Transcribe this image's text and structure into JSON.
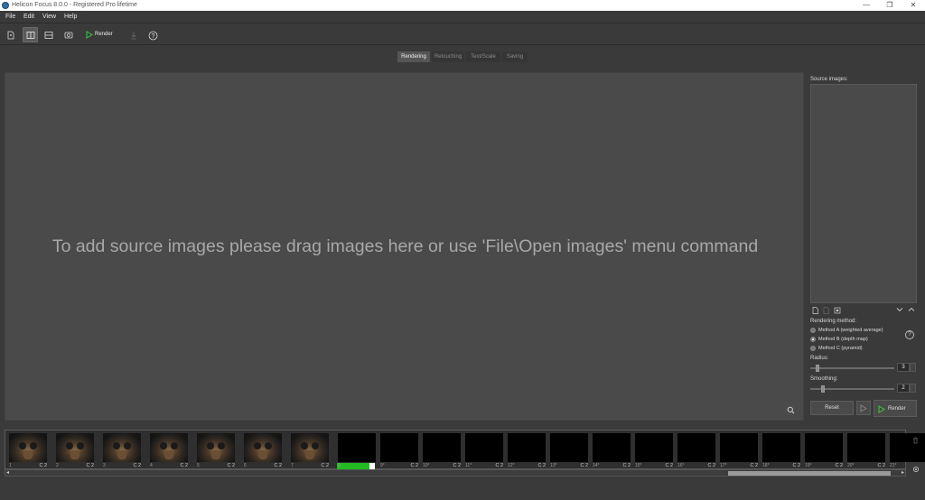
{
  "window": {
    "title": "Helicon Focus 8.0.0 - Registered Pro lifetime"
  },
  "menu": [
    "File",
    "Edit",
    "View",
    "Help"
  ],
  "toolbar": {
    "render_label": "Render"
  },
  "tabs": [
    {
      "label": "Rendering",
      "selected": true
    },
    {
      "label": "Retouching",
      "selected": false
    },
    {
      "label": "Text/Scale",
      "selected": false
    },
    {
      "label": "Saving",
      "selected": false
    }
  ],
  "canvas": {
    "message": "To add source images please drag images here or use 'File\\Open images' menu command"
  },
  "panel": {
    "source_label": "Source images:",
    "method_label": "Rendering method:",
    "methods": [
      {
        "label": "Method A (weighted average)",
        "selected": false
      },
      {
        "label": "Method B (depth map)",
        "selected": true
      },
      {
        "label": "Method C (pyramid)",
        "selected": false
      }
    ],
    "radius_label": "Radius:",
    "radius_value": "3",
    "smoothing_label": "Smoothing:",
    "smoothing_value": "2",
    "reset_label": "Reset",
    "render_label": "Render"
  },
  "filmstrip": [
    {
      "num": "1",
      "tag": "C 2",
      "kind": "photo"
    },
    {
      "num": "2",
      "tag": "C 2",
      "kind": "photo"
    },
    {
      "num": "3",
      "tag": "C 2",
      "kind": "photo"
    },
    {
      "num": "4",
      "tag": "C 2",
      "kind": "photo"
    },
    {
      "num": "5",
      "tag": "C 2",
      "kind": "photo"
    },
    {
      "num": "6",
      "tag": "C 2",
      "kind": "photo"
    },
    {
      "num": "7",
      "tag": "C 2",
      "kind": "photo"
    },
    {
      "num": "8",
      "tag": "",
      "kind": "loading",
      "progress": 0.85
    },
    {
      "num": "9*",
      "tag": "C 2",
      "kind": "black"
    },
    {
      "num": "10*",
      "tag": "C 2",
      "kind": "black"
    },
    {
      "num": "11*",
      "tag": "C 2",
      "kind": "black"
    },
    {
      "num": "12*",
      "tag": "C 2",
      "kind": "black"
    },
    {
      "num": "13*",
      "tag": "C 2",
      "kind": "black"
    },
    {
      "num": "14*",
      "tag": "C 2",
      "kind": "black"
    },
    {
      "num": "15*",
      "tag": "C 2",
      "kind": "black"
    },
    {
      "num": "16*",
      "tag": "C 2",
      "kind": "black"
    },
    {
      "num": "17*",
      "tag": "C 2",
      "kind": "black"
    },
    {
      "num": "18*",
      "tag": "C 2",
      "kind": "black"
    },
    {
      "num": "19*",
      "tag": "C 2",
      "kind": "black"
    },
    {
      "num": "20*",
      "tag": "C 2",
      "kind": "black"
    },
    {
      "num": "21*",
      "tag": "",
      "kind": "black"
    }
  ],
  "colors": {
    "accent": "#22bb22",
    "canvas": "#4a4a4a",
    "background": "#3a3a3a"
  }
}
